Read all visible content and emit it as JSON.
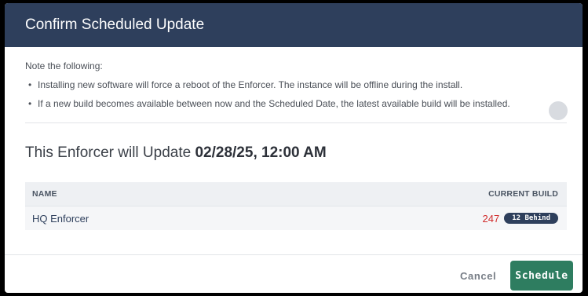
{
  "dialog": {
    "title": "Confirm Scheduled Update",
    "note_title": "Note the following:",
    "bullets": [
      "Installing new software will force a reboot of the Enforcer. The instance will be offline during the install.",
      "If a new build becomes available between now and the Scheduled Date, the latest available build will be installed."
    ],
    "update_prefix": "This Enforcer will Update",
    "update_date": "02/28/25, 12:00 AM"
  },
  "table": {
    "headers": {
      "name": "NAME",
      "build": "CURRENT BUILD"
    },
    "rows": [
      {
        "name": "HQ Enforcer",
        "build": "247",
        "badge": "12 Behind"
      }
    ]
  },
  "footer": {
    "cancel_label": "Cancel",
    "schedule_label": "Schedule"
  },
  "colors": {
    "header_bg": "#2e3f5c",
    "primary_button": "#2e7d60",
    "build_behind": "#d12b2b"
  }
}
